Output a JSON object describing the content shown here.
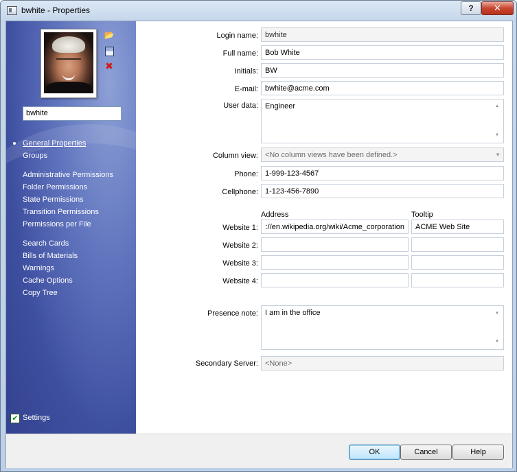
{
  "window": {
    "title": "bwhite - Properties",
    "help_label": "?",
    "close_label": "✕"
  },
  "sidebar": {
    "username": "bwhite",
    "groups": [
      [
        "General Properties",
        "Groups"
      ],
      [
        "Administrative Permissions",
        "Folder Permissions",
        "State Permissions",
        "Transition Permissions",
        "Permissions per File"
      ],
      [
        "Search Cards",
        "Bills of Materials",
        "Warnings",
        "Cache Options",
        "Copy Tree"
      ]
    ],
    "active_item": "General Properties",
    "settings_label": "Settings",
    "settings_checked": true
  },
  "form": {
    "login_name": {
      "label": "Login name:",
      "value": "bwhite"
    },
    "full_name": {
      "label": "Full name:",
      "value": "Bob White"
    },
    "initials": {
      "label": "Initials:",
      "value": "BW"
    },
    "email": {
      "label": "E-mail:",
      "value": "bwhite@acme.com"
    },
    "user_data": {
      "label": "User data:",
      "value": "Engineer"
    },
    "column_view": {
      "label": "Column view:",
      "value": "<No column views have been defined.>"
    },
    "phone": {
      "label": "Phone:",
      "value": "1-999-123-4567"
    },
    "cellphone": {
      "label": "Cellphone:",
      "value": "1-123-456-7890"
    },
    "websites_header": {
      "address": "Address",
      "tooltip": "Tooltip"
    },
    "websites": [
      {
        "label": "Website 1:",
        "address": "://en.wikipedia.org/wiki/Acme_corporation",
        "tooltip": "ACME Web Site"
      },
      {
        "label": "Website 2:",
        "address": "",
        "tooltip": ""
      },
      {
        "label": "Website 3:",
        "address": "",
        "tooltip": ""
      },
      {
        "label": "Website 4:",
        "address": "",
        "tooltip": ""
      }
    ],
    "presence_note": {
      "label": "Presence note:",
      "value": "I am in the office"
    },
    "secondary_server": {
      "label": "Secondary Server:",
      "value": "<None>"
    }
  },
  "buttons": {
    "ok": "OK",
    "cancel": "Cancel",
    "help": "Help"
  }
}
